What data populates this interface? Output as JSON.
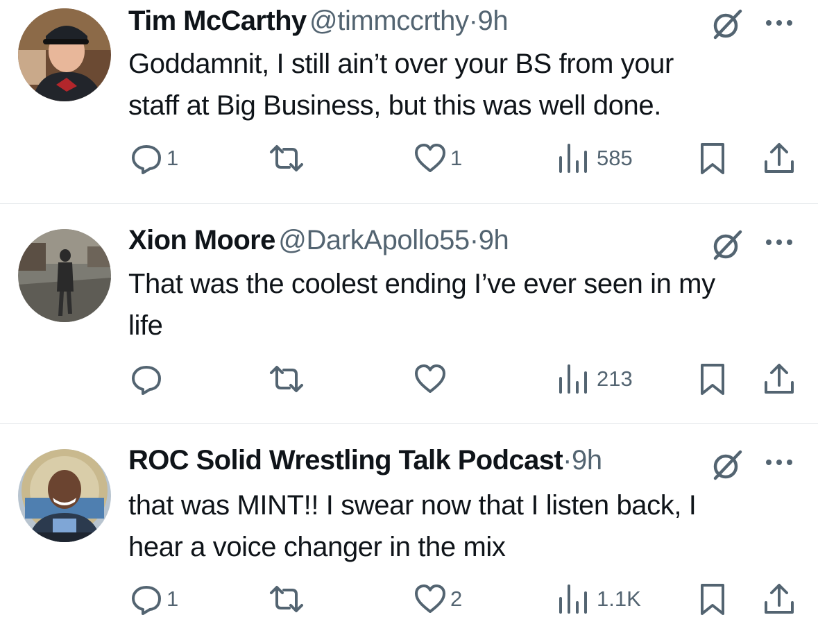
{
  "colors": {
    "text": "#0f1419",
    "secondary": "#536471",
    "divider": "#e1e5e8",
    "background": "#ffffff"
  },
  "tweets": [
    {
      "name": "Tim McCarthy",
      "handle": "@timmccrthy",
      "dot": "·",
      "time": "9h",
      "text_lines": [
        "Goddamnit, I still ain’t over your BS from your",
        "staff at Big Business, but this was well done."
      ],
      "replies": "1",
      "retweets": "",
      "likes": "1",
      "views": "585",
      "icons": {
        "reply": "reply-icon",
        "retweet": "retweet-icon",
        "like": "heart-icon",
        "views": "views-icon",
        "bookmark": "bookmark-icon",
        "share": "share-icon",
        "grok": "grok-icon",
        "more": "more-icon"
      }
    },
    {
      "name": "Xion Moore",
      "handle": "@DarkApollo55",
      "dot": "·",
      "time": "9h",
      "text_lines": [
        "That was the coolest ending I’ve ever seen in my",
        "life"
      ],
      "replies": "",
      "retweets": "",
      "likes": "",
      "views": "213",
      "icons": {
        "reply": "reply-icon",
        "retweet": "retweet-icon",
        "like": "heart-icon",
        "views": "views-icon",
        "bookmark": "bookmark-icon",
        "share": "share-icon",
        "grok": "grok-icon",
        "more": "more-icon"
      }
    },
    {
      "name": "ROC Solid Wrestling Talk Podcast",
      "handle": "",
      "dot": "·",
      "time": "9h",
      "text_lines": [
        "that was MINT!! I swear now that I listen back, I",
        "hear a voice changer in the mix"
      ],
      "replies": "1",
      "retweets": "",
      "likes": "2",
      "views": "1.1K",
      "icons": {
        "reply": "reply-icon",
        "retweet": "retweet-icon",
        "like": "heart-icon",
        "views": "views-icon",
        "bookmark": "bookmark-icon",
        "share": "share-icon",
        "grok": "grok-icon",
        "more": "more-icon"
      }
    }
  ]
}
